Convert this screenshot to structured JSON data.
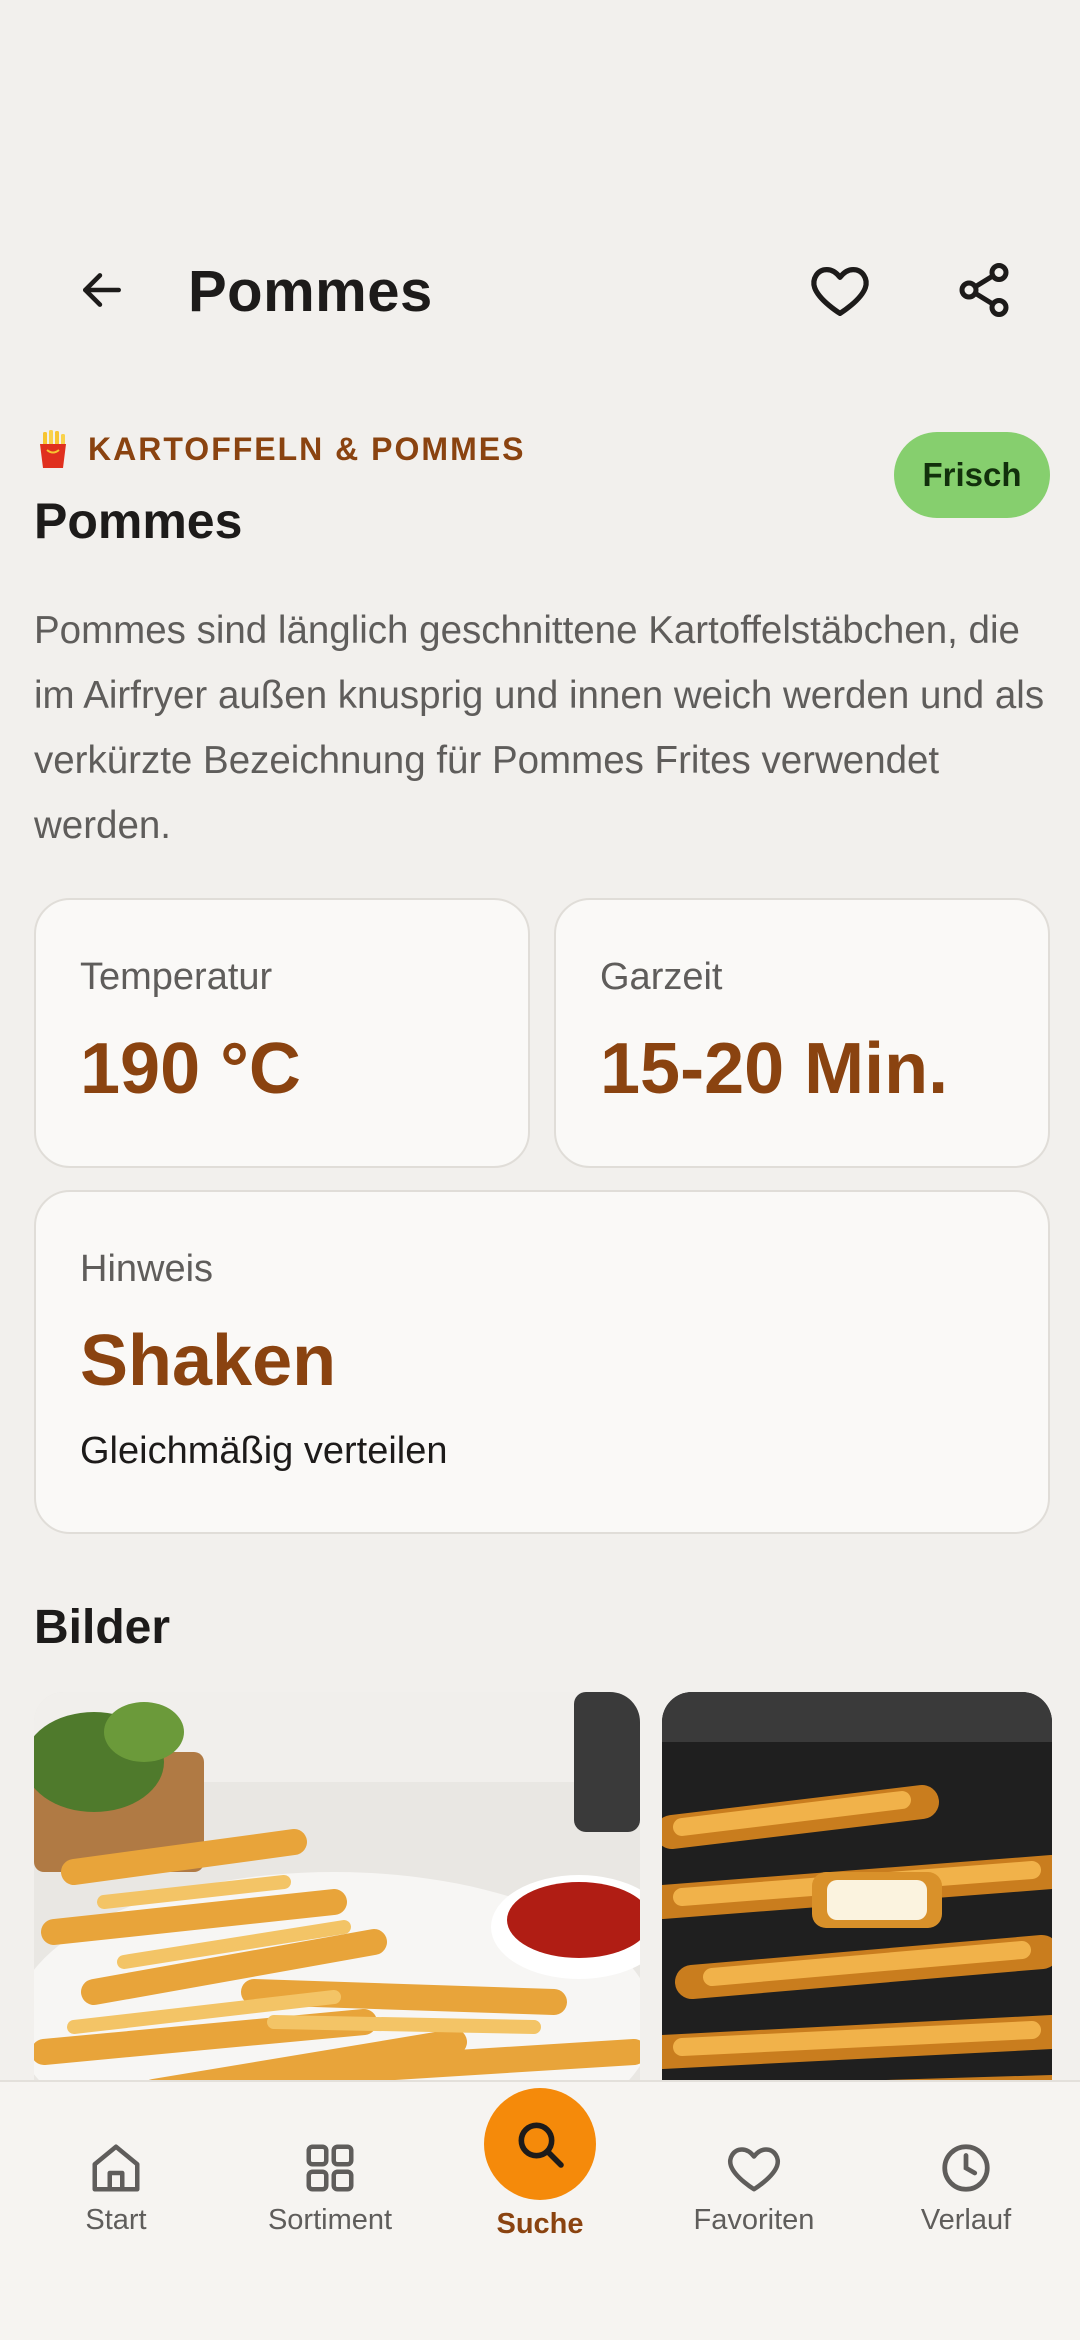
{
  "header": {
    "title": "Pommes",
    "back_icon": "arrow-left-icon",
    "favorite_icon": "heart-outline-icon",
    "share_icon": "share-icon"
  },
  "product": {
    "category_icon": "fries-icon",
    "category": "KARTOFFELN & POMMES",
    "badge": "Frisch",
    "name": "Pommes",
    "description": "Pommes sind länglich geschnittene Kartoffelstäbchen, die im Airfryer außen knusprig und innen weich werden und als verkürzte Bezeichnung für Pommes Frites verwendet werden."
  },
  "cards": {
    "temperature": {
      "label": "Temperatur",
      "value": "190 °C"
    },
    "time": {
      "label": "Garzeit",
      "value": "15-20 Min."
    },
    "note": {
      "label": "Hinweis",
      "value": "Shaken",
      "sub": "Gleichmäßig verteilen"
    }
  },
  "gallery": {
    "title": "Bilder"
  },
  "nav": {
    "items": [
      {
        "label": "Start",
        "icon": "home-icon"
      },
      {
        "label": "Sortiment",
        "icon": "grid-icon"
      },
      {
        "label": "Suche",
        "icon": "search-icon"
      },
      {
        "label": "Favoriten",
        "icon": "heart-icon"
      },
      {
        "label": "Verlauf",
        "icon": "clock-icon"
      }
    ],
    "active": "Suche"
  },
  "colors": {
    "accent": "#8a4310",
    "search_button": "#f58a0a",
    "badge": "#86cf6e",
    "background": "#f2f0ed"
  }
}
